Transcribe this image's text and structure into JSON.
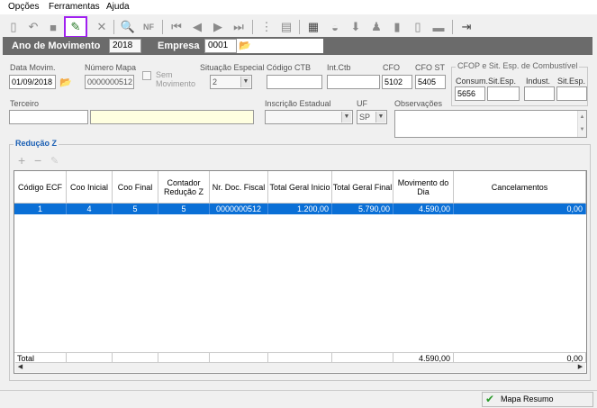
{
  "menu": [
    "Opções",
    "Ferramentas",
    "Ajuda"
  ],
  "toolbar": {
    "icons": [
      "new-icon",
      "undo-icon",
      "stop-icon",
      "edit-icon",
      "delete-icon",
      "preview-icon",
      "nf-icon",
      "first-icon",
      "prev-icon",
      "next-icon",
      "last-icon",
      "tree-icon",
      "list-icon",
      "report-icon",
      "chart-icon",
      "export-icon",
      "user-icon",
      "doc-icon",
      "minus-icon",
      "exit-icon"
    ],
    "nf_label": "NF"
  },
  "header": {
    "ano_label": "Ano de Movimento",
    "ano_value": "2018",
    "empresa_label": "Empresa",
    "empresa_value": "0001"
  },
  "form": {
    "data_movim_label": "Data Movim.",
    "data_movim_value": "01/09/2018",
    "numero_mapa_label": "Número Mapa",
    "numero_mapa_value": "0000000512",
    "sem_movimento_label_1": "Sem",
    "sem_movimento_label_2": "Movimento",
    "situacao_label": "Situação Especial",
    "situacao_value": "2",
    "codigo_ctb_label": "Código CTB",
    "codigo_ctb_value": "",
    "int_ctb_label": "Int.Ctb",
    "int_ctb_value": "",
    "cfo_label": "CFO",
    "cfo_value": "5102",
    "cfo_st_label": "CFO ST",
    "cfo_st_value": "5405",
    "cfop_group_label": "CFOP e Sit. Esp. de Combustível",
    "consum_label": "Consum.",
    "consum_value": "5656",
    "sit_esp1_label": "Sit.Esp.",
    "indust_label": "Indust.",
    "sit_esp2_label": "Sit.Esp.",
    "terceiro_label": "Terceiro",
    "inscricao_label": "Inscrição Estadual",
    "uf_label": "UF",
    "uf_value": "SP",
    "observacoes_label": "Observações"
  },
  "reducao": {
    "group_label": "Redução Z",
    "columns": [
      "Código ECF",
      "Coo Inicial",
      "Coo Final",
      "Contador Redução Z",
      "Nr. Doc. Fiscal",
      "Total Geral Inicio",
      "Total Geral Final",
      "Movimento do Dia",
      "Cancelamentos"
    ],
    "row": [
      "1",
      "4",
      "5",
      "5",
      "0000000512",
      "1.200,00",
      "5.790,00",
      "4.590,00",
      "0,00"
    ],
    "total_label": "Total",
    "total_movimento": "4.590,00",
    "total_cancelamentos": "0,00"
  },
  "status": {
    "mapa_resumo": "Mapa Resumo"
  }
}
